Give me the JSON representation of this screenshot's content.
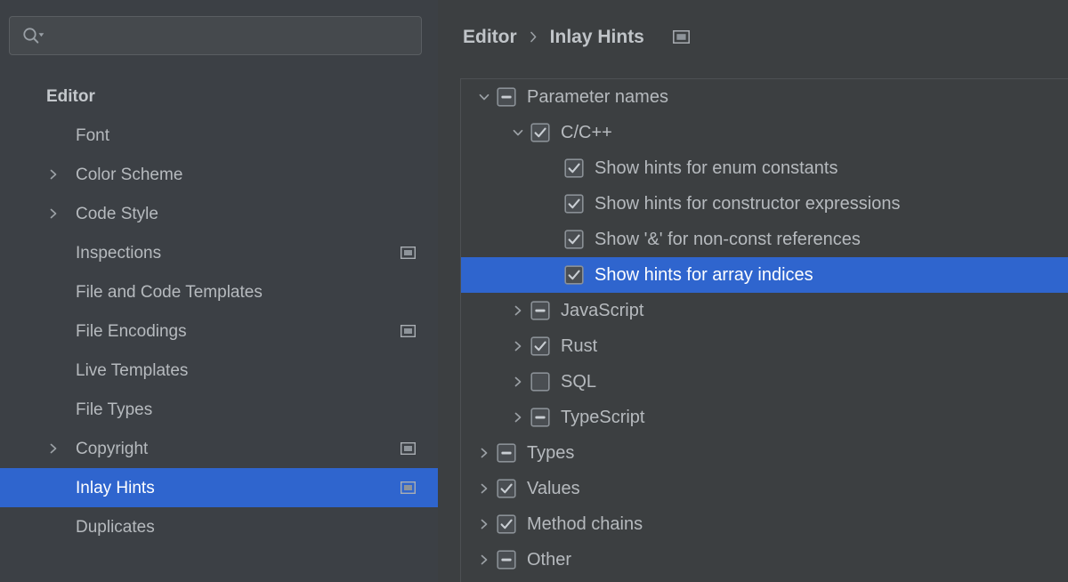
{
  "colors": {
    "accent_selection": "#2F65CE",
    "sidebar_bg": "#3C4045",
    "content_bg": "#3C3F41",
    "text": "#B6BABE",
    "text_selected": "#FFFFFF",
    "panel_border": "#4D5053",
    "search_bg": "#45494D"
  },
  "search": {
    "value": "",
    "placeholder": "",
    "icon": "search-icon",
    "dropdown_icon": "chevron-down-icon"
  },
  "sidebar": {
    "items": [
      {
        "label": "Editor",
        "level": 0,
        "expandable": false,
        "expanded": false,
        "selected": false,
        "scope_icon": false
      },
      {
        "label": "Font",
        "level": 1,
        "expandable": false,
        "expanded": false,
        "selected": false,
        "scope_icon": false
      },
      {
        "label": "Color Scheme",
        "level": 1,
        "expandable": true,
        "expanded": false,
        "selected": false,
        "scope_icon": false
      },
      {
        "label": "Code Style",
        "level": 1,
        "expandable": true,
        "expanded": false,
        "selected": false,
        "scope_icon": false
      },
      {
        "label": "Inspections",
        "level": 1,
        "expandable": false,
        "expanded": false,
        "selected": false,
        "scope_icon": true
      },
      {
        "label": "File and Code Templates",
        "level": 1,
        "expandable": false,
        "expanded": false,
        "selected": false,
        "scope_icon": false
      },
      {
        "label": "File Encodings",
        "level": 1,
        "expandable": false,
        "expanded": false,
        "selected": false,
        "scope_icon": true
      },
      {
        "label": "Live Templates",
        "level": 1,
        "expandable": false,
        "expanded": false,
        "selected": false,
        "scope_icon": false
      },
      {
        "label": "File Types",
        "level": 1,
        "expandable": false,
        "expanded": false,
        "selected": false,
        "scope_icon": false
      },
      {
        "label": "Copyright",
        "level": 1,
        "expandable": true,
        "expanded": false,
        "selected": false,
        "scope_icon": true
      },
      {
        "label": "Inlay Hints",
        "level": 1,
        "expandable": false,
        "expanded": false,
        "selected": true,
        "scope_icon": true
      },
      {
        "label": "Duplicates",
        "level": 1,
        "expandable": false,
        "expanded": false,
        "selected": false,
        "scope_icon": false
      }
    ]
  },
  "breadcrumb": {
    "items": [
      "Editor",
      "Inlay Hints"
    ],
    "separator": "chevron-right-icon",
    "scope_icon": "project-scope-icon"
  },
  "tree": {
    "rows": [
      {
        "label": "Parameter names",
        "level": 0,
        "expandable": true,
        "expanded": true,
        "check": "indeterminate",
        "selected": false
      },
      {
        "label": "C/C++",
        "level": 1,
        "expandable": true,
        "expanded": true,
        "check": "checked",
        "selected": false
      },
      {
        "label": "Show hints for enum constants",
        "level": 2,
        "expandable": false,
        "expanded": false,
        "check": "checked",
        "selected": false
      },
      {
        "label": "Show hints for constructor expressions",
        "level": 2,
        "expandable": false,
        "expanded": false,
        "check": "checked",
        "selected": false
      },
      {
        "label": "Show '&' for non-const references",
        "level": 2,
        "expandable": false,
        "expanded": false,
        "check": "checked",
        "selected": false
      },
      {
        "label": "Show hints for array indices",
        "level": 2,
        "expandable": false,
        "expanded": false,
        "check": "checked",
        "selected": true
      },
      {
        "label": "JavaScript",
        "level": 1,
        "expandable": true,
        "expanded": false,
        "check": "indeterminate",
        "selected": false
      },
      {
        "label": "Rust",
        "level": 1,
        "expandable": true,
        "expanded": false,
        "check": "checked",
        "selected": false
      },
      {
        "label": "SQL",
        "level": 1,
        "expandable": true,
        "expanded": false,
        "check": "unchecked",
        "selected": false
      },
      {
        "label": "TypeScript",
        "level": 1,
        "expandable": true,
        "expanded": false,
        "check": "indeterminate",
        "selected": false
      },
      {
        "label": "Types",
        "level": 0,
        "expandable": true,
        "expanded": false,
        "check": "indeterminate",
        "selected": false
      },
      {
        "label": "Values",
        "level": 0,
        "expandable": true,
        "expanded": false,
        "check": "checked",
        "selected": false
      },
      {
        "label": "Method chains",
        "level": 0,
        "expandable": true,
        "expanded": false,
        "check": "checked",
        "selected": false
      },
      {
        "label": "Other",
        "level": 0,
        "expandable": true,
        "expanded": false,
        "check": "indeterminate",
        "selected": false
      }
    ]
  }
}
